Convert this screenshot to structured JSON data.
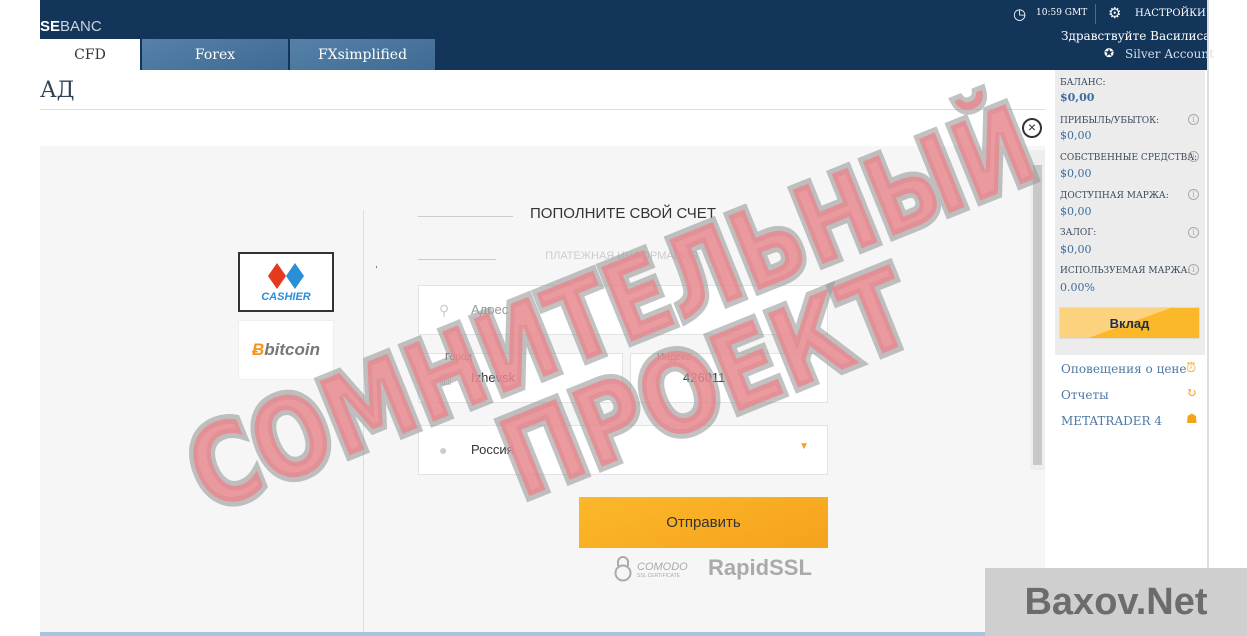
{
  "header": {
    "logo_bold": "SE",
    "logo_rest": "BANC",
    "time": "10:59 GMT",
    "settings": "НАСТРОЙКИ",
    "greeting": "Здравствуйте Василиса",
    "account": "Silver Account",
    "tabs": [
      {
        "label": "CFD",
        "active": true
      },
      {
        "label": "Forex"
      },
      {
        "label": "FXsimplified"
      }
    ]
  },
  "page_title": "АД",
  "payment_methods": [
    {
      "label": "CASHIER",
      "selected": true
    },
    {
      "label": "bitcoin"
    }
  ],
  "form": {
    "title": "ПОПОЛНИТЕ СВОЙ СЧЕТ",
    "subtitle": "ПЛАТЕЖНАЯ ИНФОРМАЦИЯ:",
    "address_placeholder": "Адрес",
    "city_label": "Город",
    "city_value": "Izhevsk",
    "zip_label": "Индекс",
    "zip_value": "426011",
    "country_value": "Россия",
    "submit": "Отправить"
  },
  "ssl": {
    "comodo": "COMODO",
    "comodo_sub": "SSL CERTIFICATE",
    "rapid": "RapidSSL"
  },
  "sidebar": {
    "stats": [
      {
        "label": "БАЛАНС:",
        "value": "$0,00"
      },
      {
        "label": "ПРИБЫЛЬ/УБЫТОК:",
        "value": "$0,00"
      },
      {
        "label": "СОБСТВЕННЫЕ СРЕДСТВА:",
        "value": "$0,00"
      },
      {
        "label": "ДОСТУПНАЯ МАРЖА:",
        "value": "$0,00"
      },
      {
        "label": "ЗАЛОГ:",
        "value": "$0,00"
      },
      {
        "label": "ИСПОЛЬЗУЕМАЯ МАРЖА:",
        "value": "0.00%"
      }
    ],
    "deposit": "Вклад",
    "links": [
      {
        "label": "Оповещения о цене",
        "icon": "alarm-clock-icon"
      },
      {
        "label": "Отчеты",
        "icon": "refresh-icon"
      },
      {
        "label": "METATRADER 4",
        "icon": "mt4-icon"
      }
    ]
  },
  "watermark": {
    "line1": "СОМНИТЕЛЬНЫЙ",
    "line2": "ПРОЕКТ",
    "site": "Baxov.Net"
  },
  "colors": {
    "header": "#14355a",
    "accent": "#f6a21d",
    "stamp": "#e88a8e"
  }
}
